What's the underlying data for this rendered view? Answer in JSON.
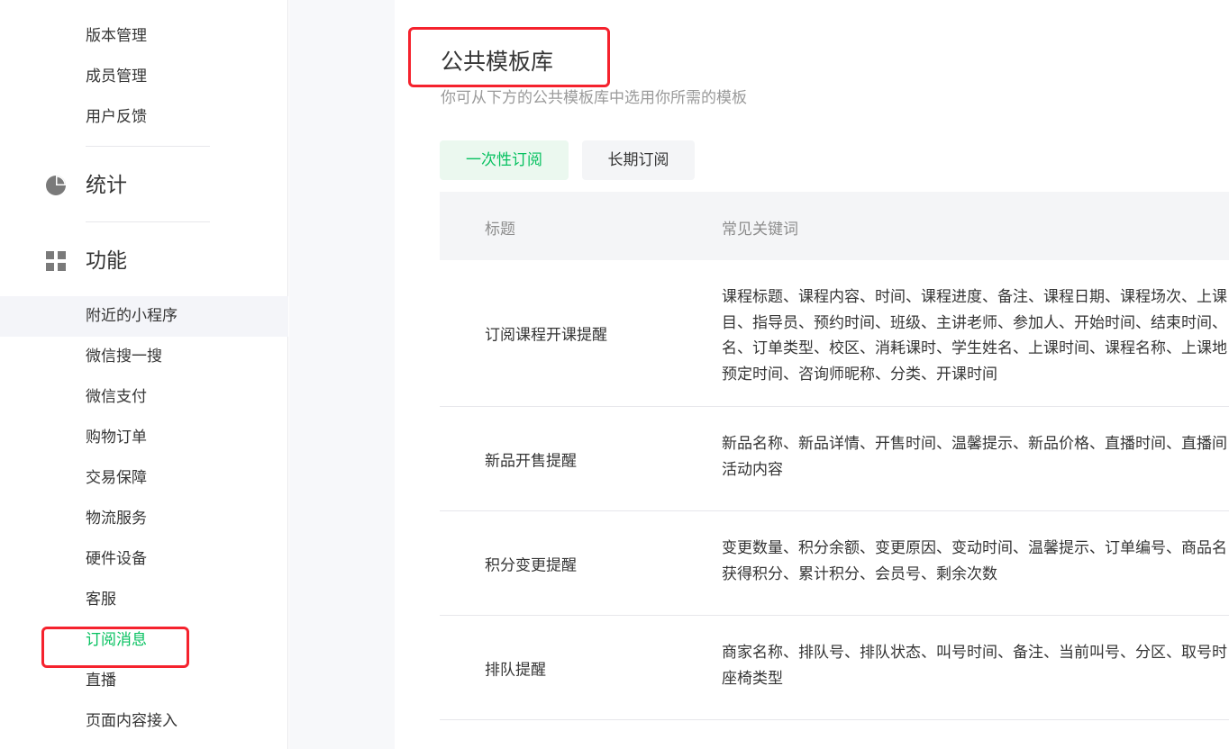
{
  "sidebar": {
    "items_top": [
      {
        "label": "版本管理"
      },
      {
        "label": "成员管理"
      },
      {
        "label": "用户反馈"
      }
    ],
    "stats_section": {
      "label": "统计",
      "icon": "pie-chart-icon"
    },
    "func_section": {
      "label": "功能",
      "icon": "grid-icon"
    },
    "func_items": [
      {
        "label": "附近的小程序"
      },
      {
        "label": "微信搜一搜"
      },
      {
        "label": "微信支付"
      },
      {
        "label": "购物订单"
      },
      {
        "label": "交易保障"
      },
      {
        "label": "物流服务"
      },
      {
        "label": "硬件设备"
      },
      {
        "label": "客服"
      },
      {
        "label": "订阅消息"
      },
      {
        "label": "直播"
      },
      {
        "label": "页面内容接入"
      }
    ]
  },
  "main": {
    "title": "公共模板库",
    "description": "你可从下方的公共模板库中选用你所需的模板",
    "tabs": [
      {
        "label": "一次性订阅"
      },
      {
        "label": "长期订阅"
      }
    ],
    "table": {
      "headers": {
        "title": "标题",
        "keywords": "常见关键词"
      },
      "rows": [
        {
          "title": "订阅课程开课提醒",
          "keyword_lines": [
            "课程标题、课程内容、时间、课程进度、备注、课程日期、课程场次、上课",
            "目、指导员、预约时间、班级、主讲老师、参加人、开始时间、结束时间、",
            "名、订单类型、校区、消耗课时、学生姓名、上课时间、课程名称、上课地",
            "预定时间、咨询师昵称、分类、开课时间"
          ]
        },
        {
          "title": "新品开售提醒",
          "keyword_lines": [
            "新品名称、新品详情、开售时间、温馨提示、新品价格、直播时间、直播间",
            "活动内容"
          ]
        },
        {
          "title": "积分变更提醒",
          "keyword_lines": [
            "变更数量、积分余额、变更原因、变动时间、温馨提示、订单编号、商品名",
            "获得积分、累计积分、会员号、剩余次数"
          ]
        },
        {
          "title": "排队提醒",
          "keyword_lines": [
            "商家名称、排队号、排队状态、叫号时间、备注、当前叫号、分区、取号时",
            "座椅类型"
          ]
        }
      ]
    }
  },
  "colors": {
    "accent": "#07c160",
    "highlight_box": "#f5222d"
  }
}
